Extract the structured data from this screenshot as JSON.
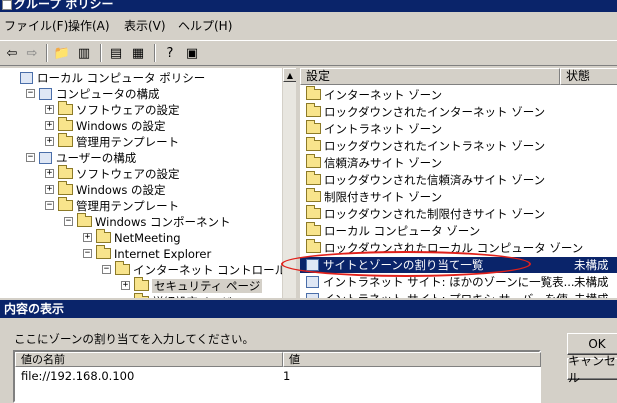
{
  "window": {
    "title": "グループ ポリシー"
  },
  "menu": [
    "ファイル(F)",
    "操作(A)",
    "表示(V)",
    "ヘルプ(H)"
  ],
  "tree": [
    {
      "label": "ローカル コンピュータ ポリシー",
      "indent": 0,
      "icon": "policy-icon"
    },
    {
      "label": "コンピュータの構成",
      "indent": 1,
      "icon": "computer-icon"
    },
    {
      "label": "ソフトウェアの設定",
      "indent": 2,
      "icon": "folder-icon"
    },
    {
      "label": "Windows の設定",
      "indent": 2,
      "icon": "folder-icon"
    },
    {
      "label": "管理用テンプレート",
      "indent": 2,
      "icon": "folder-icon"
    },
    {
      "label": "ユーザーの構成",
      "indent": 1,
      "icon": "user-icon"
    },
    {
      "label": "ソフトウェアの設定",
      "indent": 2,
      "icon": "folder-icon"
    },
    {
      "label": "Windows の設定",
      "indent": 2,
      "icon": "folder-icon"
    },
    {
      "label": "管理用テンプレート",
      "indent": 2,
      "icon": "folder-icon"
    },
    {
      "label": "Windows コンポーネント",
      "indent": 3,
      "icon": "folder-icon"
    },
    {
      "label": "NetMeeting",
      "indent": 4,
      "icon": "folder-icon"
    },
    {
      "label": "Internet Explorer",
      "indent": 4,
      "icon": "folder-icon"
    },
    {
      "label": "インターネット コントロール パネル",
      "indent": 5,
      "icon": "folder-icon"
    },
    {
      "label": "セキュリティ ページ",
      "indent": 6,
      "icon": "folder-icon"
    },
    {
      "label": "詳細設定ページ",
      "indent": 6,
      "icon": "folder-icon"
    }
  ],
  "list": {
    "columns": {
      "setting": "設定",
      "state": "状態"
    },
    "rows": [
      {
        "label": "インターネット ゾーン",
        "state": "",
        "type": "folder"
      },
      {
        "label": "ロックダウンされたインターネット ゾーン",
        "state": "",
        "type": "folder"
      },
      {
        "label": "イントラネット ゾーン",
        "state": "",
        "type": "folder"
      },
      {
        "label": "ロックダウンされたイントラネット ゾーン",
        "state": "",
        "type": "folder"
      },
      {
        "label": "信頼済みサイト ゾーン",
        "state": "",
        "type": "folder"
      },
      {
        "label": "ロックダウンされた信頼済みサイト ゾーン",
        "state": "",
        "type": "folder"
      },
      {
        "label": "制限付きサイト ゾーン",
        "state": "",
        "type": "folder"
      },
      {
        "label": "ロックダウンされた制限付きサイト ゾーン",
        "state": "",
        "type": "folder"
      },
      {
        "label": "ローカル コンピュータ ゾーン",
        "state": "",
        "type": "folder"
      },
      {
        "label": "ロックダウンされたローカル コンピュータ ゾーン",
        "state": "",
        "type": "folder"
      },
      {
        "label": "サイトとゾーンの割り当て一覧",
        "state": "未構成",
        "type": "setting",
        "selected": true
      },
      {
        "label": "イントラネット サイト: ほかのゾーンに一覧表...",
        "state": "未構成",
        "type": "setting"
      },
      {
        "label": "イントラネット サイト: プロキシ サーバーを使...",
        "state": "未構成",
        "type": "setting"
      }
    ]
  },
  "dialog": {
    "title": "内容の表示",
    "prompt": "ここにゾーンの割り当てを入力してください。",
    "columns": {
      "name": "値の名前",
      "value": "値"
    },
    "rows": [
      {
        "name": "file://192.168.0.100",
        "value": "1"
      }
    ],
    "ok_label": "OK",
    "cancel_label": "キャンセル"
  },
  "colors": {
    "titlebar": "#0a246a",
    "selection": "#0a246a",
    "highlight_ellipse": "#e0201a"
  }
}
